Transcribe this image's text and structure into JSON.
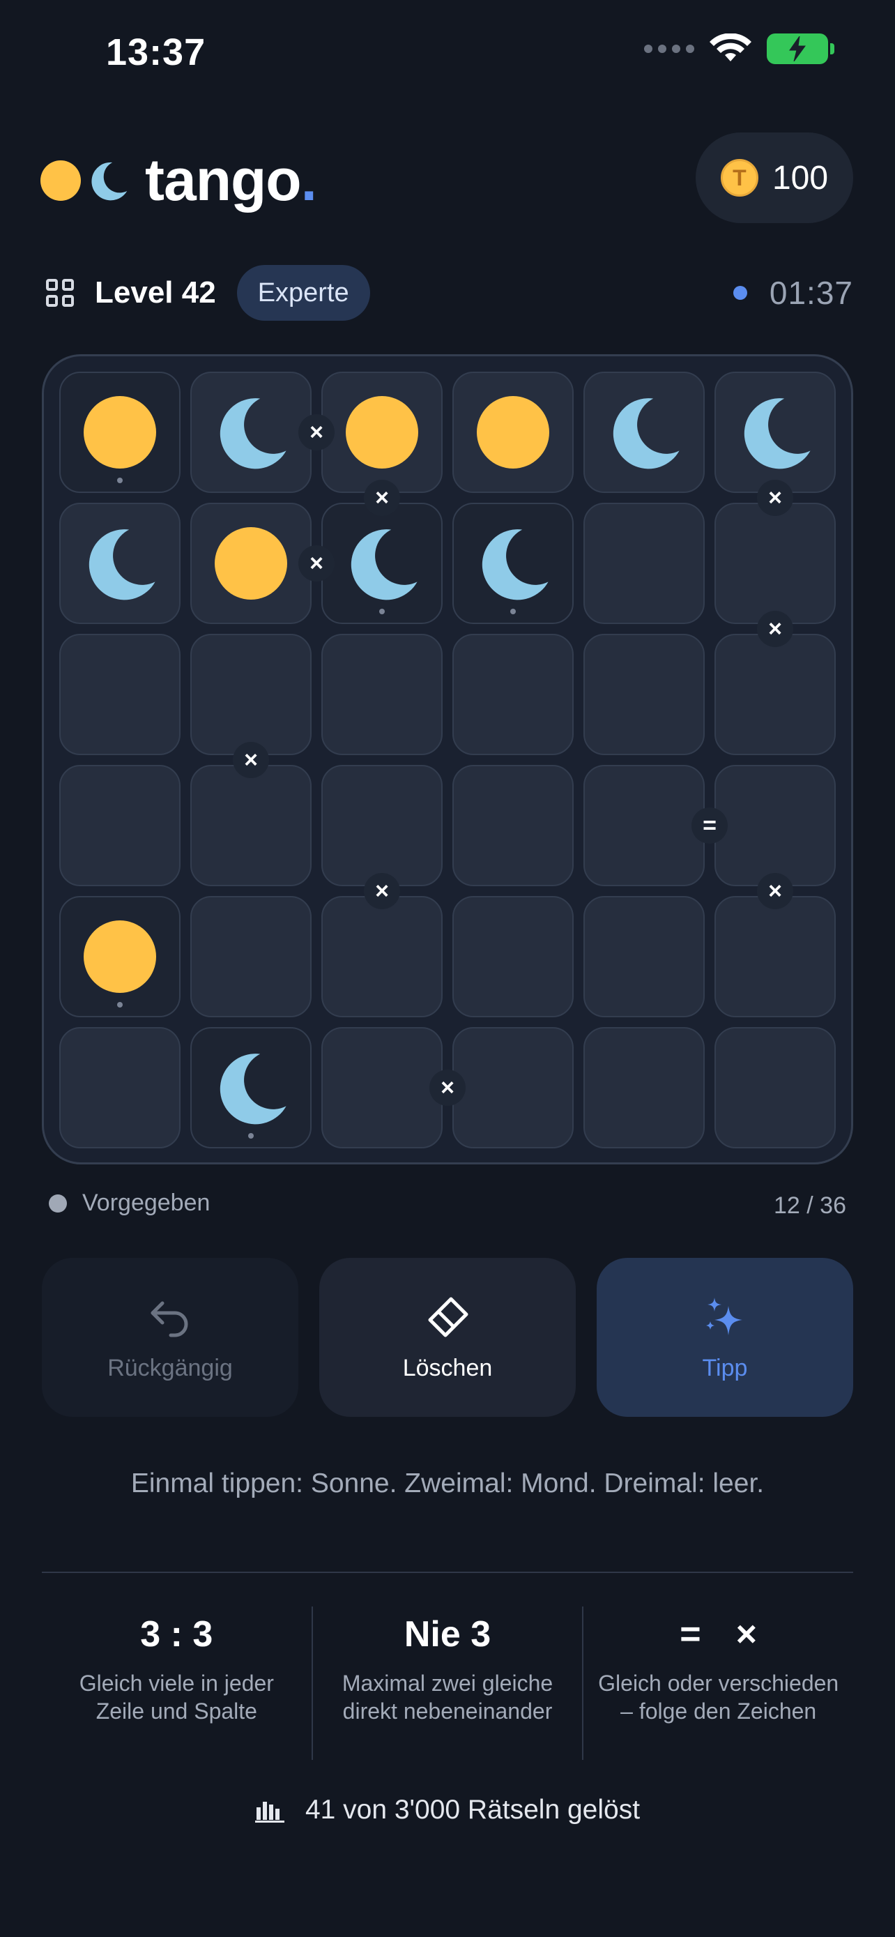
{
  "status_bar": {
    "time": "13:37"
  },
  "header": {
    "logo_text": "tango",
    "logo_dot": ".",
    "coin_symbol": "T",
    "coins": "100"
  },
  "level": {
    "label": "Level 42",
    "difficulty": "Experte",
    "timer": "01:37"
  },
  "colors": {
    "sun": "#ffc247",
    "moon": "#8fcbe8",
    "accent": "#5b8def",
    "background": "#121721"
  },
  "board": {
    "size": 6,
    "cells": [
      [
        "sun-given",
        "moon",
        "sun",
        "sun",
        "moon",
        "moon"
      ],
      [
        "moon",
        "sun",
        "moon-given",
        "moon-given",
        "",
        ""
      ],
      [
        "",
        "",
        "",
        "",
        "",
        ""
      ],
      [
        "",
        "",
        "",
        "",
        "",
        ""
      ],
      [
        "sun-given",
        "",
        "",
        "",
        "",
        ""
      ],
      [
        "",
        "moon-given",
        "",
        "",
        "",
        ""
      ]
    ],
    "constraints": [
      {
        "between": "r1c2-r1c3",
        "symbol": "×"
      },
      {
        "between": "r1c3-r2c3",
        "symbol": "×"
      },
      {
        "between": "r1c6-r2c6",
        "symbol": "×"
      },
      {
        "between": "r2c2-r2c3",
        "symbol": "×"
      },
      {
        "between": "r2c6-r3c6",
        "symbol": "×"
      },
      {
        "between": "r3c2-r4c2",
        "symbol": "×"
      },
      {
        "between": "r4c5-r4c6",
        "symbol": "="
      },
      {
        "between": "r4c3-r5c3",
        "symbol": "×"
      },
      {
        "between": "r4c6-r5c6",
        "symbol": "×"
      },
      {
        "between": "r6c3-r6c4",
        "symbol": "×"
      }
    ]
  },
  "legend": {
    "given_label": "Vorgegeben",
    "progress": "12 / 36"
  },
  "actions": {
    "undo_label": "Rückgängig",
    "erase_label": "Löschen",
    "hint_label": "Tipp"
  },
  "helper_text": "Einmal tippen: Sonne. Zweimal: Mond. Dreimal: leer.",
  "rules": [
    {
      "title": "3 : 3",
      "desc": "Gleich viele in jeder Zeile und Spalte"
    },
    {
      "title": "Nie 3",
      "desc": "Maximal zwei gleiche direkt nebeneinander"
    },
    {
      "title_eq": "=",
      "title_x": "×",
      "desc": "Gleich oder verschieden – folge den Zeichen"
    }
  ],
  "stats": {
    "text": "41 von 3'000 Rätseln gelöst"
  }
}
